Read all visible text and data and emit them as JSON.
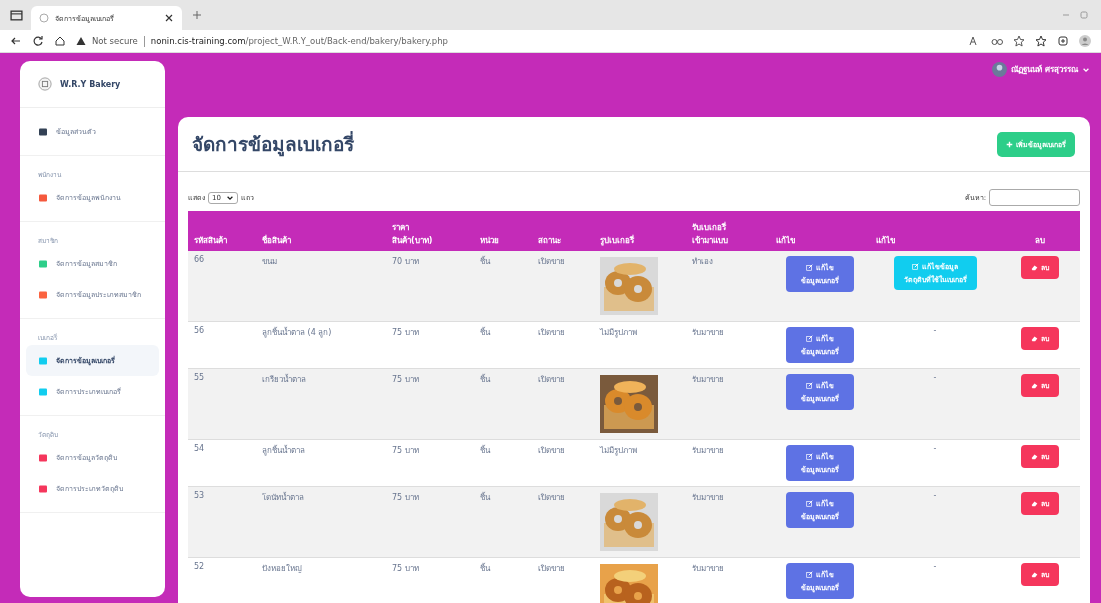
{
  "browser": {
    "tab_title": "จัดการข้อมูลเบเกอรี่",
    "security": "Not secure",
    "url_host": "nonin.cis-training.com",
    "url_path": "/project_W.R.Y_out/Back-end/bakery/bakery.php"
  },
  "sidebar": {
    "brand": "W.R.Y Bakery",
    "groups": [
      {
        "items": [
          {
            "label": "ข้อมูลส่วนตัว",
            "color": "#334155",
            "selected": false
          }
        ]
      },
      {
        "heading": "พนักงาน",
        "items": [
          {
            "label": "จัดการข้อมูลพนักงาน",
            "color": "#f5593d",
            "selected": false
          }
        ]
      },
      {
        "heading": "สมาชิก",
        "items": [
          {
            "label": "จัดการข้อมูลสมาชิก",
            "color": "#2dce89",
            "selected": false
          },
          {
            "label": "จัดการข้อมูลประเภทสมาชิก",
            "color": "#fb6340",
            "selected": false
          }
        ]
      },
      {
        "heading": "เบเกอรี่",
        "items": [
          {
            "label": "จัดการข้อมูลเบเกอรี่",
            "color": "#11cdef",
            "selected": true
          },
          {
            "label": "จัดการประเภทเบเกอรี่",
            "color": "#11cdef",
            "selected": false
          }
        ]
      },
      {
        "heading": "วัตถุดิบ",
        "items": [
          {
            "label": "จัดการข้อมูลวัตถุดิบ",
            "color": "#f5365c",
            "selected": false
          },
          {
            "label": "จัดการประเภทวัตถุดิบ",
            "color": "#f5365c",
            "selected": false
          }
        ]
      }
    ]
  },
  "user": {
    "name": "ณัฏฐนนท์ ศรสุวรรณ"
  },
  "page": {
    "title": "จัดการข้อมูลเบเกอรี่",
    "add_button": "เพิ่มข้อมูลเบเกอรี่",
    "show_label": "แสดง",
    "page_size": "10",
    "rows_label": "แถว",
    "search_label": "ค้นหา:"
  },
  "table": {
    "columns": [
      [
        "รหัสสินค้า"
      ],
      [
        "ชื่อสินค้า"
      ],
      [
        "ราคา",
        "สินค้า(บาท)"
      ],
      [
        "หน่วย"
      ],
      [
        "สถานะ"
      ],
      [
        "รูปเบเกอรี่"
      ],
      [
        "รับเบเกอรี่",
        "เข้ามาแบบ"
      ],
      [
        "แก้ไข"
      ],
      [
        "แก้ไข"
      ],
      [
        "ลบ"
      ]
    ],
    "rows": [
      {
        "id": "66",
        "name": "ขนม",
        "price": "70 บาท",
        "unit": "ชิ้น",
        "status": "เปิดขาย",
        "source": "ทำเอง",
        "edit": [
          "แก้ไข",
          "ข้อมูลเบเกอรี่"
        ],
        "edit2": {
          "kind": "button",
          "lines": [
            "แก้ไขข้อมูล",
            "วัตถุดิบที่ใช้ในเบเกอรี่"
          ]
        },
        "delete": "ลบ"
      },
      {
        "id": "56",
        "name": "ลูกชิ้นน้ำตาล (4 ลูก)",
        "price": "75 บาท",
        "unit": "ชิ้น",
        "status": "เปิดขาย",
        "image": {
          "kind": "text",
          "text": "ไม่มีรูปภาพ"
        },
        "source": "รับมาขาย",
        "edit": [
          "แก้ไข",
          "ข้อมูลเบเกอรี่"
        ],
        "edit2": {
          "kind": "text",
          "text": "-"
        },
        "delete": "ลบ"
      },
      {
        "id": "55",
        "name": "เกรียวน้ำตาล",
        "price": "75 บาท",
        "unit": "ชิ้น",
        "status": "เปิดขาย",
        "source": "รับมาขาย",
        "edit": [
          "แก้ไข",
          "ข้อมูลเบเกอรี่"
        ],
        "edit2": {
          "kind": "text",
          "text": "-"
        },
        "delete": "ลบ"
      },
      {
        "id": "54",
        "name": "ลูกชิ้นน้ำตาล",
        "price": "75 บาท",
        "unit": "ชิ้น",
        "status": "เปิดขาย",
        "image": {
          "kind": "text",
          "text": "ไม่มีรูปภาพ"
        },
        "source": "รับมาขาย",
        "edit": [
          "แก้ไข",
          "ข้อมูลเบเกอรี่"
        ],
        "edit2": {
          "kind": "text",
          "text": "-"
        },
        "delete": "ลบ"
      },
      {
        "id": "53",
        "name": "โดนัทน้ำตาล",
        "price": "75 บาท",
        "unit": "ชิ้น",
        "status": "เปิดขาย",
        "source": "รับมาขาย",
        "edit": [
          "แก้ไข",
          "ข้อมูลเบเกอรี่"
        ],
        "edit2": {
          "kind": "text",
          "text": "-"
        },
        "delete": "ลบ"
      },
      {
        "id": "52",
        "name": "ปังหอยใหญ่",
        "price": "75 บาท",
        "unit": "ชิ้น",
        "status": "เปิดขาย",
        "source": "รับมาขาย",
        "edit": [
          "แก้ไข",
          "ข้อมูลเบเกอรี่"
        ],
        "edit2": {
          "kind": "text",
          "text": "-"
        },
        "delete": "ลบ"
      }
    ]
  }
}
